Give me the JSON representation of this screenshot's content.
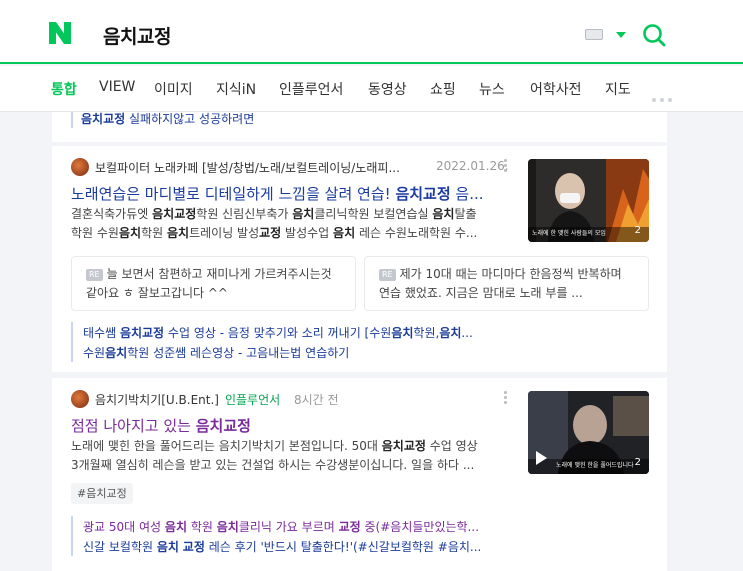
{
  "search": {
    "query": "음치교정"
  },
  "tabs": [
    "통합",
    "VIEW",
    "이미지",
    "지식iN",
    "인플루언서",
    "동영상",
    "쇼핑",
    "뉴스",
    "어학사전",
    "지도"
  ],
  "top_link": {
    "bold": "음치교정",
    "rest": " 실패하지않고 성공하려면"
  },
  "result1": {
    "blog_name": "보컬파이터 노래카페 [발성/창법/노래/보컬트레이닝/노래피...",
    "date": "2022.01.26.",
    "title_a": "노래연습은 마디별로 디테일하게 느낌을 살려 연습! ",
    "title_bold": "음치교정",
    "title_b": " 음...",
    "desc_line1": [
      [
        "결혼식축가듀엣 ",
        false
      ],
      [
        "음치교정",
        true
      ],
      [
        "학원 신림신부축가 ",
        false
      ],
      [
        "음치",
        true
      ],
      [
        "클리닉학원 보컬연습실 ",
        false
      ],
      [
        "음치",
        true
      ],
      [
        "탈출",
        false
      ]
    ],
    "desc_line2": [
      [
        "학원 수원",
        false
      ],
      [
        "음치",
        true
      ],
      [
        "학원 ",
        false
      ],
      [
        "음치",
        true
      ],
      [
        "트레이닝 발성",
        false
      ],
      [
        "교정",
        true
      ],
      [
        " 발성수업 ",
        false
      ],
      [
        "음치",
        true
      ],
      [
        " 레슨 수원노래학원 수...",
        false
      ]
    ],
    "thumb_caption": "노래에 한 맺힌 사람들의 모임",
    "thumb_count": "2",
    "comment_label": "RE",
    "comment1": "늘 보면서 참편하고 재미나게 가르켜주시는것 같아요 ㅎ 잘보고갑니다 ^^",
    "comment2": "제가 10대 때는 마디마다 한음정씩 반복하며 연습 했었죠. 지금은 맘대로 노래 부를 ...",
    "sub1": [
      [
        "태수쌤 ",
        false
      ],
      [
        "음치교정",
        true
      ],
      [
        " 수업 영상 - 음정 맞추기와 소리 꺼내기 [수원",
        false
      ],
      [
        "음치",
        true
      ],
      [
        "학원,",
        false
      ],
      [
        "음치",
        true
      ],
      [
        "...",
        false
      ]
    ],
    "sub2": [
      [
        "수원",
        false
      ],
      [
        "음치",
        true
      ],
      [
        "학원 성준쌤 레슨영상 - 고음내는법 연습하기",
        false
      ]
    ]
  },
  "result2": {
    "blog_name": "음치기박치기[U.B.Ent.]",
    "influencer": "인플루언서",
    "date": "8시간 전",
    "title_a": "점점 나아지고 있는 ",
    "title_bold": "음치교정",
    "desc_line1": [
      [
        "노래에 맺힌 한을 풀어드리는 음치기박치기 본점입니다. 50대 ",
        false
      ],
      [
        "음치교정",
        true
      ],
      [
        " 수업 영상",
        false
      ]
    ],
    "desc_line2": [
      [
        "3개월째 열심히 레슨을 받고 있는 건설업 하시는 수강생분이십니다. 일을 하다 ...",
        false
      ]
    ],
    "thumb_caption": "노래에 맺힌 한을 풀어드립니다",
    "thumb_count": "2",
    "hashtag": "#음치교정",
    "sub1": [
      [
        "광교 50대 여성 ",
        false
      ],
      [
        "음치",
        true
      ],
      [
        " 학원 ",
        false
      ],
      [
        "음치",
        true
      ],
      [
        "클리닉 가요 부르며 ",
        false
      ],
      [
        "교정",
        true
      ],
      [
        " 중(#음치들만있는학...",
        false
      ]
    ],
    "sub2": [
      [
        "신갈 보컬학원 ",
        false
      ],
      [
        "음치",
        true
      ],
      [
        " ",
        false
      ],
      [
        "교정",
        true
      ],
      [
        " 레슨 후기 '반드시 탈출한다!'(#신갈보컬학원 #음치...",
        false
      ]
    ]
  },
  "colors": {
    "naver_green": "#03c75a",
    "link_blue": "#1a3ba0",
    "visited_purple": "#7a2a9a"
  }
}
